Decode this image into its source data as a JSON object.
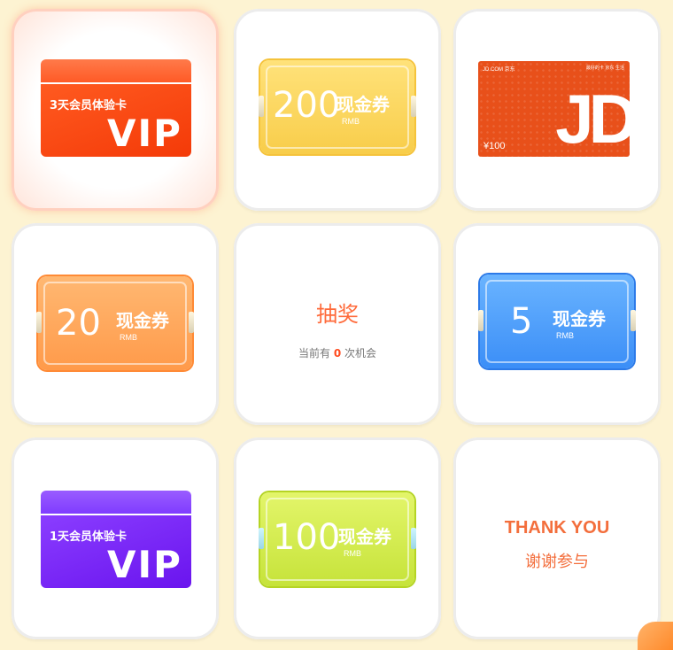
{
  "cells": [
    {
      "vip_days": "3天会员体验卡",
      "vip_text": "VIP",
      "color": "#f43a08"
    },
    {
      "num": "200",
      "word": "现金券",
      "rmb": "RMB",
      "color": "#f8cd4a"
    },
    {
      "jd_logo": "JD.COM 京东",
      "jd_right": "最好的卡 京东 生活",
      "jd_big": "JD",
      "jd_price": "¥100",
      "color": "#e8501a"
    },
    {
      "num": "20",
      "word": "现金券",
      "rmb": "RMB",
      "color": "#ff9a4a"
    },
    {
      "title": "抽奖",
      "sub_prefix": "当前有",
      "count": "0",
      "sub_suffix": "次机会"
    },
    {
      "num": "5",
      "word": "现金券",
      "rmb": "RMB",
      "color": "#3b8ef7"
    },
    {
      "vip_days": "1天会员体验卡",
      "vip_text": "VIP",
      "color": "#6a14ee"
    },
    {
      "num": "100",
      "word": "现金券",
      "rmb": "RMB",
      "color": "#c6e33a"
    },
    {
      "en": "THANK YOU",
      "cn": "谢谢参与"
    }
  ]
}
